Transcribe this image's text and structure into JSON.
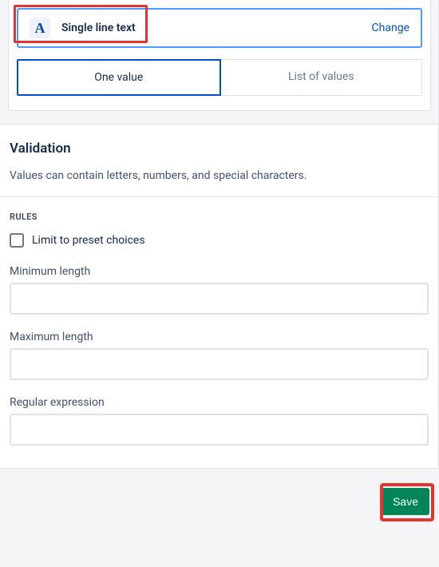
{
  "fieldType": {
    "iconLetter": "A",
    "label": "Single line text",
    "changeLink": "Change"
  },
  "tabs": {
    "oneValue": "One value",
    "listOfValues": "List of values"
  },
  "validation": {
    "title": "Validation",
    "description": "Values can contain letters, numbers, and special characters.",
    "rulesHeading": "RULES",
    "limitPreset": "Limit to preset choices",
    "minLengthLabel": "Minimum length",
    "maxLengthLabel": "Maximum length",
    "regexLabel": "Regular expression",
    "minLengthValue": "",
    "maxLengthValue": "",
    "regexValue": ""
  },
  "footer": {
    "saveLabel": "Save"
  }
}
